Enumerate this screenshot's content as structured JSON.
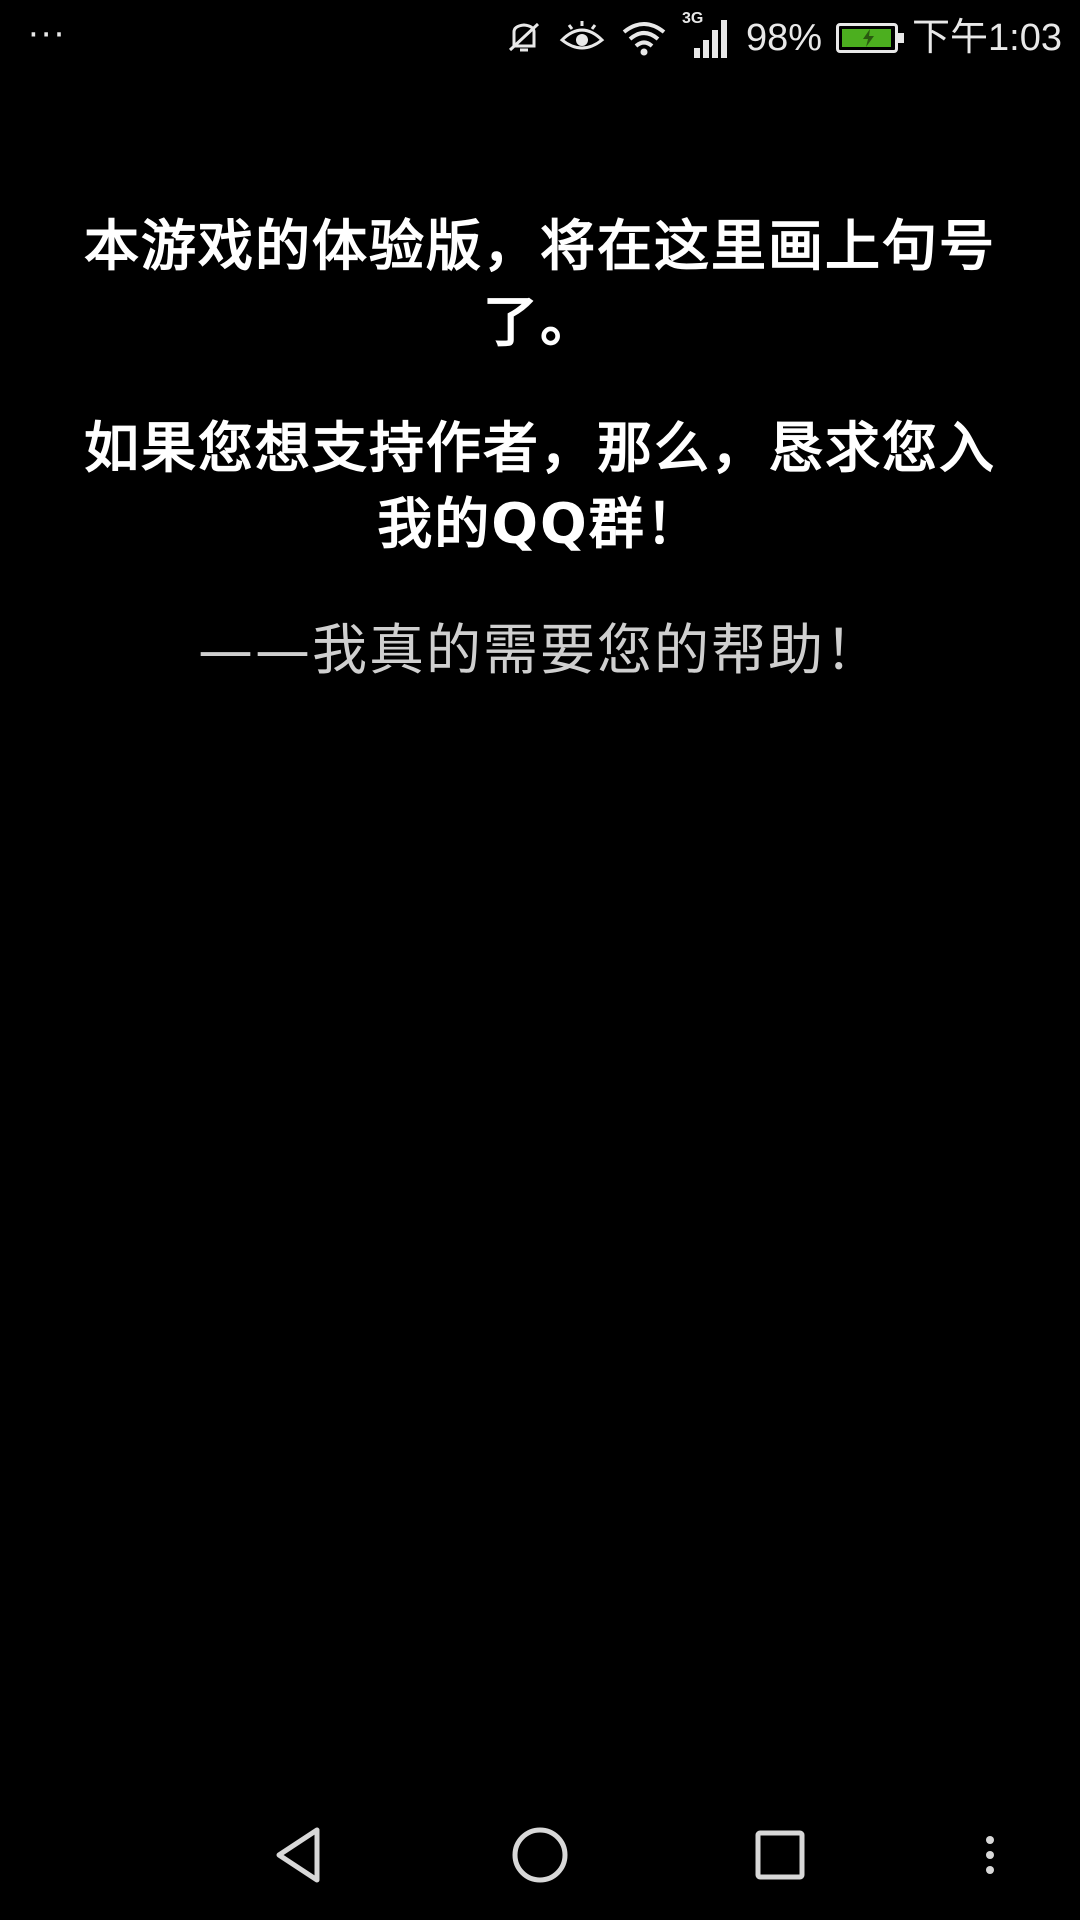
{
  "status_bar": {
    "notification_dots": "···",
    "icons": [
      "mute-icon",
      "eye-comfort-icon",
      "wifi-icon",
      "signal-icon",
      "battery-icon"
    ],
    "network_type": "3G",
    "battery_percent": "98%",
    "battery_level": 0.98,
    "time": "下午1:03"
  },
  "message": {
    "line1": "本游戏的体验版，将在这里画上句号了。",
    "line2": "如果您想支持作者，那么，恳求您入我的QQ群！",
    "line3": "——我真的需要您的帮助！"
  },
  "nav_bar": {
    "buttons": [
      "back-icon",
      "home-icon",
      "recent-apps-icon",
      "more-icon"
    ]
  },
  "colors": {
    "background": "#000000",
    "text_primary": "#ffffff",
    "text_secondary": "#cfcfcf",
    "battery_green": "#4caf1f"
  }
}
